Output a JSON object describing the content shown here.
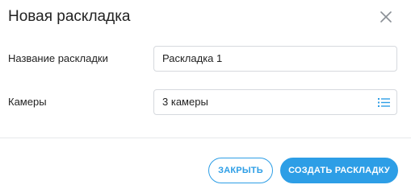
{
  "dialog": {
    "title": "Новая раскладка",
    "close_icon": "close-icon"
  },
  "form": {
    "layout_name": {
      "label": "Название раскладки",
      "value": "Раскладка 1"
    },
    "cameras": {
      "label": "Камеры",
      "value": "3 камеры",
      "icon": "list-icon"
    }
  },
  "footer": {
    "close_label": "ЗАКРЫТЬ",
    "create_label": "СОЗДАТЬ РАСКЛАДКУ"
  },
  "colors": {
    "accent": "#2d9ee6",
    "text": "#222222",
    "border": "#d6d9de",
    "icon_gray": "#8a8f96"
  }
}
